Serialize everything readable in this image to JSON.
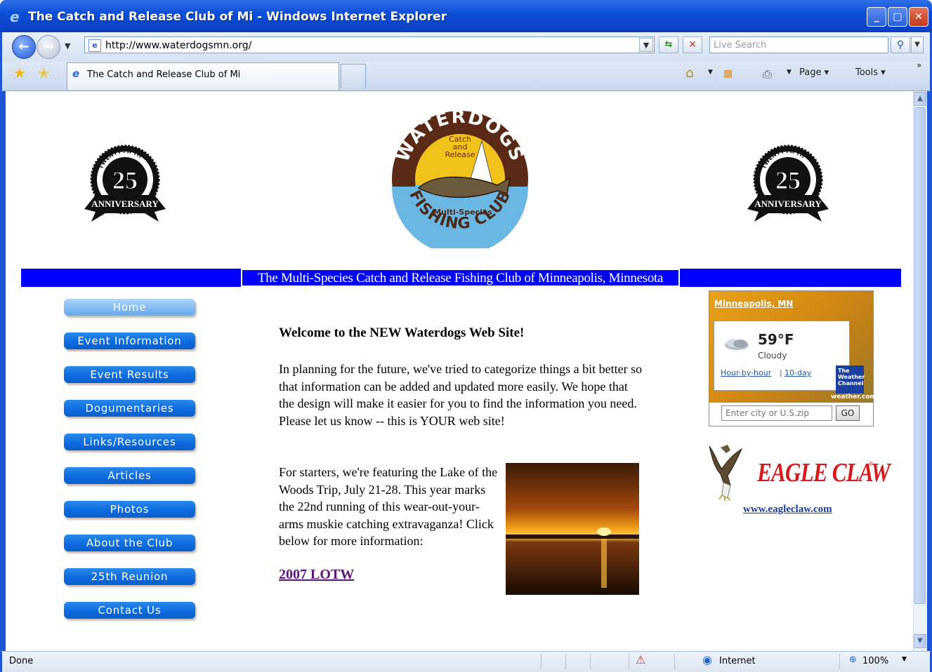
{
  "window": {
    "title": "The Catch and Release Club of Mi - Windows Internet Explorer",
    "min": "_",
    "max": "□",
    "close": "✕"
  },
  "toolbar": {
    "address": "http://www.waterdogsmn.org/",
    "search_placeholder": "Live Search",
    "tab_title": "The Catch and Release Club of Mi",
    "page_menu": "Page ▾",
    "tools_menu": "Tools ▾"
  },
  "logo": {
    "top": "WATERDOGS",
    "center": [
      "Catch",
      "and",
      "Release"
    ],
    "multi": "Multi-Species",
    "bottom": "FISHING CLUB"
  },
  "anniversary_badge": {
    "arc_text": "TWENTY-FIFTH",
    "number": "25",
    "ribbon": "ANNIVERSARY"
  },
  "banner": "The Multi-Species Catch and Release Fishing Club of Minneapolis, Minnesota",
  "nav": [
    {
      "label": "Home",
      "active": true
    },
    {
      "label": "Event Information"
    },
    {
      "label": "Event Results"
    },
    {
      "label": "Dogumentaries"
    },
    {
      "label": "Links/Resources"
    },
    {
      "label": "Articles"
    },
    {
      "label": "Photos"
    },
    {
      "label": "About the Club"
    },
    {
      "label": "25th Reunion"
    },
    {
      "label": "Contact Us"
    }
  ],
  "main": {
    "welcome": "Welcome to the NEW Waterdogs Web Site!",
    "para1": "In planning for the future, we've tried to categorize things a bit better so that information can be added and updated more easily. We hope that the design will make it easier for you to find the information you need. Please let us know -- this is YOUR web site!",
    "para2": "For starters, we're featuring the Lake of the Woods Trip, July 21-28. This year marks the 22nd running of this wear-out-your-arms muskie catching extravaganza! Click below for more information:",
    "link": "2007 LOTW"
  },
  "weather": {
    "city": "Minneapolis, MN",
    "temp": "59°F",
    "condition": "Cloudy",
    "hour_link": "Hour-by-hour",
    "sep": "|",
    "day10_link": "10-day",
    "brand": "The Weather Channel",
    "site": "weather.com",
    "input_placeholder": "Enter city or U.S.zip",
    "go": "GO"
  },
  "sponsor": {
    "name": "EAGLE CLAW",
    "reg": "®",
    "url": "www.eagleclaw.com"
  },
  "status": {
    "text": "Done",
    "zone": "Internet",
    "zoom": "100%"
  },
  "colors": {
    "banner": "#0000ff",
    "nav_button": "#0d6ce0",
    "nav_active": "#7db8f3",
    "link_visited": "#5b167e",
    "eagle_red": "#d51b1b"
  }
}
